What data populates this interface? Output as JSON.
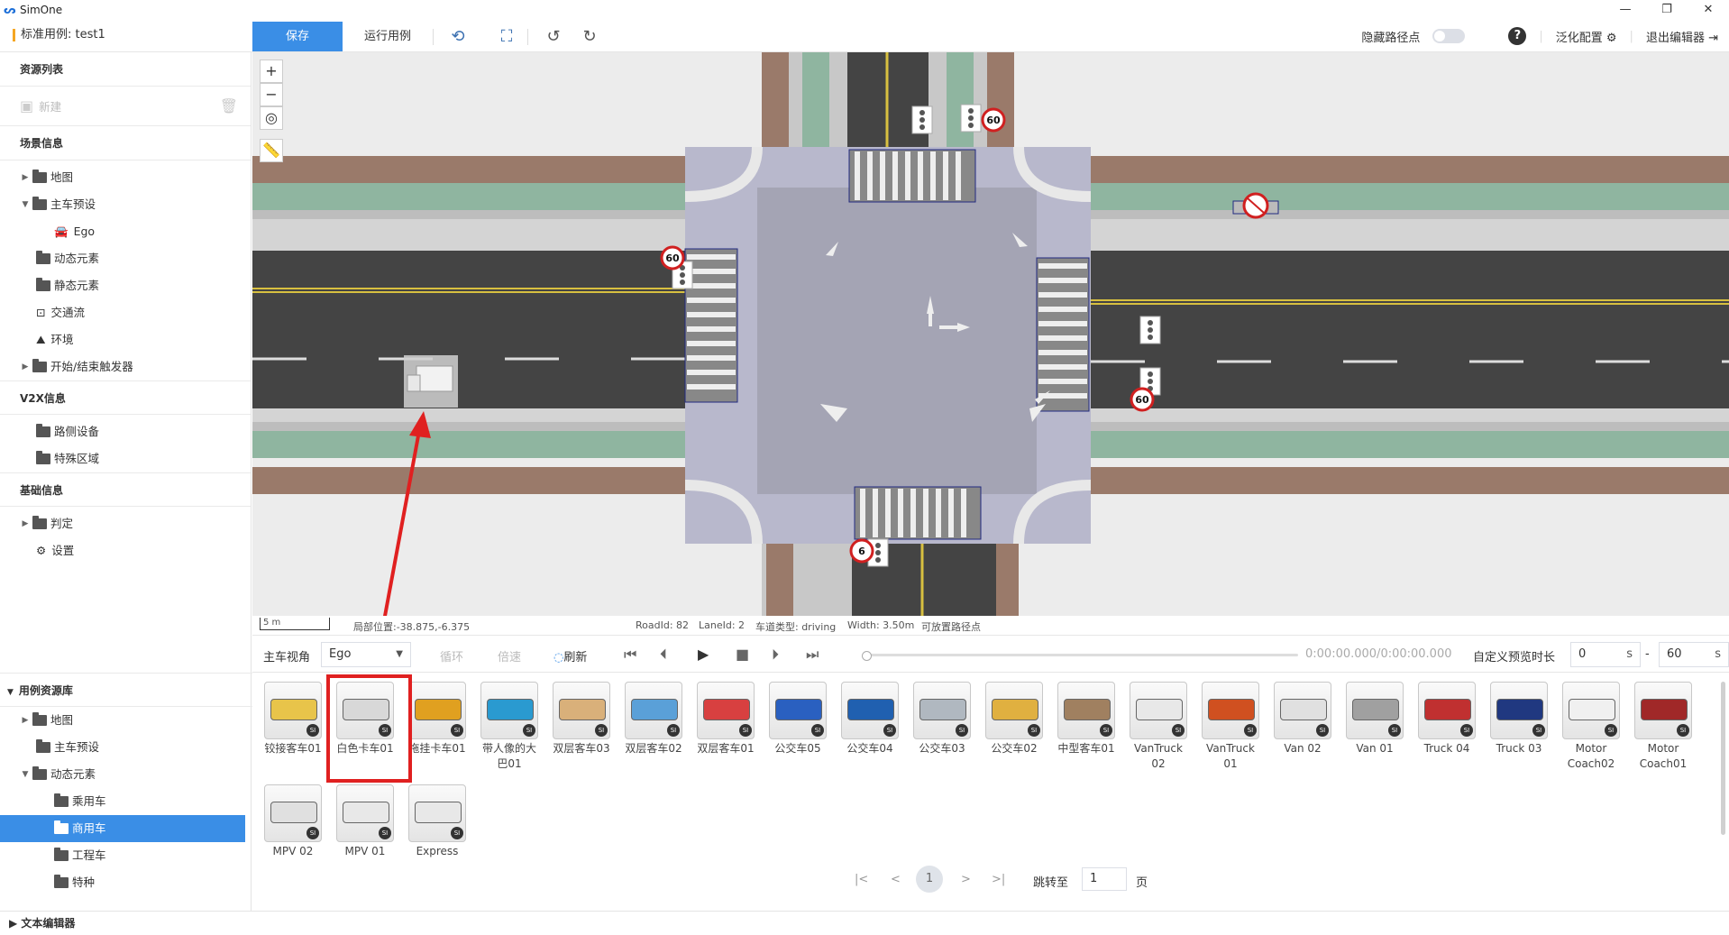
{
  "window": {
    "title": "SimOne",
    "controls": [
      "—",
      "❐",
      "✕"
    ]
  },
  "toolbar": {
    "case_name": "标准用例: test1",
    "save_label": "保存",
    "run_label": "运行用例",
    "hide_path_label": "隐藏路径点",
    "help_label": "?",
    "generalize_label": "泛化配置",
    "exit_label": "退出编辑器"
  },
  "sidebar": {
    "resource_list": "资源列表",
    "new_label": "新建",
    "scene_info": "场景信息",
    "scene_items": [
      {
        "label": "地图",
        "arrow": "▶"
      },
      {
        "label": "主车预设",
        "arrow": "▼"
      },
      {
        "label": "Ego"
      },
      {
        "label": "动态元素"
      },
      {
        "label": "静态元素"
      },
      {
        "label": "交通流"
      },
      {
        "label": "环境"
      },
      {
        "label": "开始/结束触发器",
        "arrow": "▶"
      }
    ],
    "v2x_info": "V2X信息",
    "v2x_items": [
      {
        "label": "路侧设备"
      },
      {
        "label": "特殊区域"
      }
    ],
    "basic_info": "基础信息",
    "basic_items": [
      {
        "label": "判定",
        "arrow": "▶"
      },
      {
        "label": "设置"
      }
    ]
  },
  "resource_library": {
    "title": "用例资源库",
    "items": [
      {
        "label": "地图",
        "arrow": "▶"
      },
      {
        "label": "主车预设"
      },
      {
        "label": "动态元素",
        "arrow": "▼"
      },
      {
        "label": "乘用车"
      },
      {
        "label": "商用车",
        "selected": true
      },
      {
        "label": "工程车"
      },
      {
        "label": "特种"
      }
    ]
  },
  "map": {
    "zoom_in": "+",
    "zoom_out": "−",
    "speed_limit": "60",
    "speed_limit_partial": "6"
  },
  "status": {
    "scale": "5 m",
    "local_pos": "局部位置:-38.875,-6.375",
    "road_id": "RoadId: 82",
    "lane_id": "LaneId: 2",
    "lane_type": "车道类型: driving",
    "width": "Width: 3.50m",
    "placeable": "可放置路径点"
  },
  "playbar": {
    "view_label": "主车视角",
    "view_value": "Ego",
    "loop_label": "循环",
    "speed_label": "倍速",
    "refresh_label": "刷新",
    "time": "0:00:00.000/0:00:00.000",
    "preview_label": "自定义预览时长",
    "start_value": "0",
    "end_value": "60",
    "unit": "s",
    "dash": "-"
  },
  "gallery": {
    "badge": "SI",
    "assets": [
      {
        "name": "铰接客车01",
        "color": "#e8c44a"
      },
      {
        "name": "白色卡车01",
        "color": "#d8d8d8"
      },
      {
        "name": "拖挂卡车01",
        "color": "#e0a020"
      },
      {
        "name": "带人像的大巴01",
        "color": "#2a9ad0"
      },
      {
        "name": "双层客车03",
        "color": "#d9b07a"
      },
      {
        "name": "双层客车02",
        "color": "#5aa0d8"
      },
      {
        "name": "双层客车01",
        "color": "#d84040"
      },
      {
        "name": "公交车05",
        "color": "#2a60c0"
      },
      {
        "name": "公交车04",
        "color": "#2060b0"
      },
      {
        "name": "公交车03",
        "color": "#b0b8c0"
      },
      {
        "name": "公交车02",
        "color": "#e0b040"
      },
      {
        "name": "中型客车01",
        "color": "#a08060"
      },
      {
        "name": "VanTruck 02",
        "color": "#e8e8e8"
      },
      {
        "name": "VanTruck 01",
        "color": "#d05020"
      },
      {
        "name": "Van 02",
        "color": "#e0e0e0"
      },
      {
        "name": "Van 01",
        "color": "#a0a0a0"
      },
      {
        "name": "Truck 04",
        "color": "#c03030"
      },
      {
        "name": "Truck 03",
        "color": "#203880"
      },
      {
        "name": "Motor Coach02",
        "color": "#f0f0f0"
      },
      {
        "name": "Motor Coach01",
        "color": "#a02828"
      },
      {
        "name": "MPV 02",
        "color": "#e0e0e0"
      },
      {
        "name": "MPV 01",
        "color": "#e8e8e8"
      },
      {
        "name": "Express",
        "color": "#e8e8e8"
      }
    ]
  },
  "pager": {
    "first": "|<",
    "prev": "<",
    "page": "1",
    "next": ">",
    "last": ">|",
    "goto_label": "跳转至",
    "goto_value": "1",
    "page_unit": "页"
  },
  "text_editor": "▶ 文本编辑器"
}
